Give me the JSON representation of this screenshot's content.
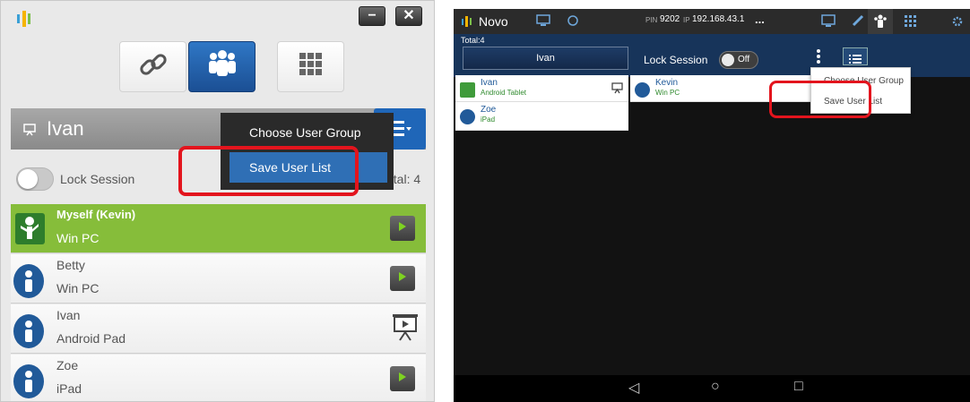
{
  "left": {
    "window_buttons": {
      "minimize": "−",
      "close": "✕"
    },
    "top_buttons": [
      "link-icon",
      "users-icon",
      "grid-icon"
    ],
    "current_user": "Ivan",
    "lock_label": "Lock Session",
    "total_label": "otal: 4",
    "dropdown": {
      "items": [
        "Choose User Group",
        "Save User List"
      ],
      "selected": 1
    },
    "users": [
      {
        "name": "Myself (Kevin)",
        "device": "Win PC",
        "action": "play"
      },
      {
        "name": "Betty",
        "device": "Win PC",
        "action": "play"
      },
      {
        "name": "Ivan",
        "device": "Android Pad",
        "action": "presenting"
      },
      {
        "name": "Zoe",
        "device": "iPad",
        "action": "play"
      }
    ],
    "colors": {
      "accent": "#2f6fb5",
      "me": "#86bd3a",
      "highlight": "#e3141d"
    }
  },
  "right": {
    "app_title": "Novo",
    "pin_prefix": "PIN",
    "pin": "9202",
    "ip_prefix": "IP",
    "ip": "192.168.43.1",
    "ellipsis": "...",
    "total": "Total:4",
    "current_user": "Ivan",
    "lock_label": "Lock Session",
    "lock_state": "Off",
    "users": [
      {
        "name": "Ivan",
        "device": "Android Tablet"
      },
      {
        "name": "Kevin",
        "device": "Win PC"
      },
      {
        "name": "Zoe",
        "device": "iPad"
      }
    ],
    "dropdown": {
      "items": [
        "Choose User Group",
        "Save User List"
      ]
    },
    "nav": {
      "back": "◁",
      "home": "○",
      "recent": "□"
    }
  }
}
